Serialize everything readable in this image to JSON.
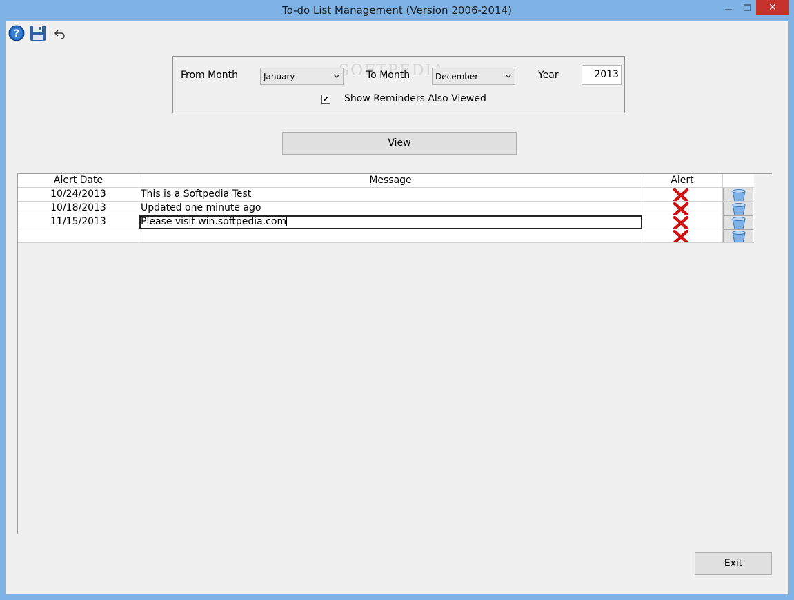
{
  "window": {
    "title": "To-do List Management (Version 2006-2014)",
    "close_label": "✕"
  },
  "toolbar": {
    "help_icon": "help-icon",
    "save_icon": "save-icon",
    "undo_icon": "undo-icon"
  },
  "filter": {
    "from_month_label": "From Month",
    "from_month_value": "January",
    "to_month_label": "To Month",
    "to_month_value": "December",
    "year_label": "Year",
    "year_value": "2013",
    "show_reminders_label": "Show Reminders Also Viewed",
    "show_reminders_checked": true,
    "check_mark": "✔",
    "watermark": "SOFTPEDIA"
  },
  "view_button": "View",
  "grid": {
    "headers": [
      "Alert Date",
      "Message",
      "Alert"
    ],
    "rows": [
      {
        "date": "10/24/2013",
        "message": "This is a Softpedia Test"
      },
      {
        "date": "10/18/2013",
        "message": "Updated one minute ago"
      },
      {
        "date": "11/15/2013",
        "message": "Please visit win.softpedia.com"
      },
      {
        "date": "",
        "message": ""
      }
    ]
  },
  "exit_button": "Exit",
  "colors": {
    "title_bar": "#7fb3e6",
    "close_button": "#c7312b",
    "alert_x": "#cc1111",
    "bucket": "#7fb2e8"
  }
}
